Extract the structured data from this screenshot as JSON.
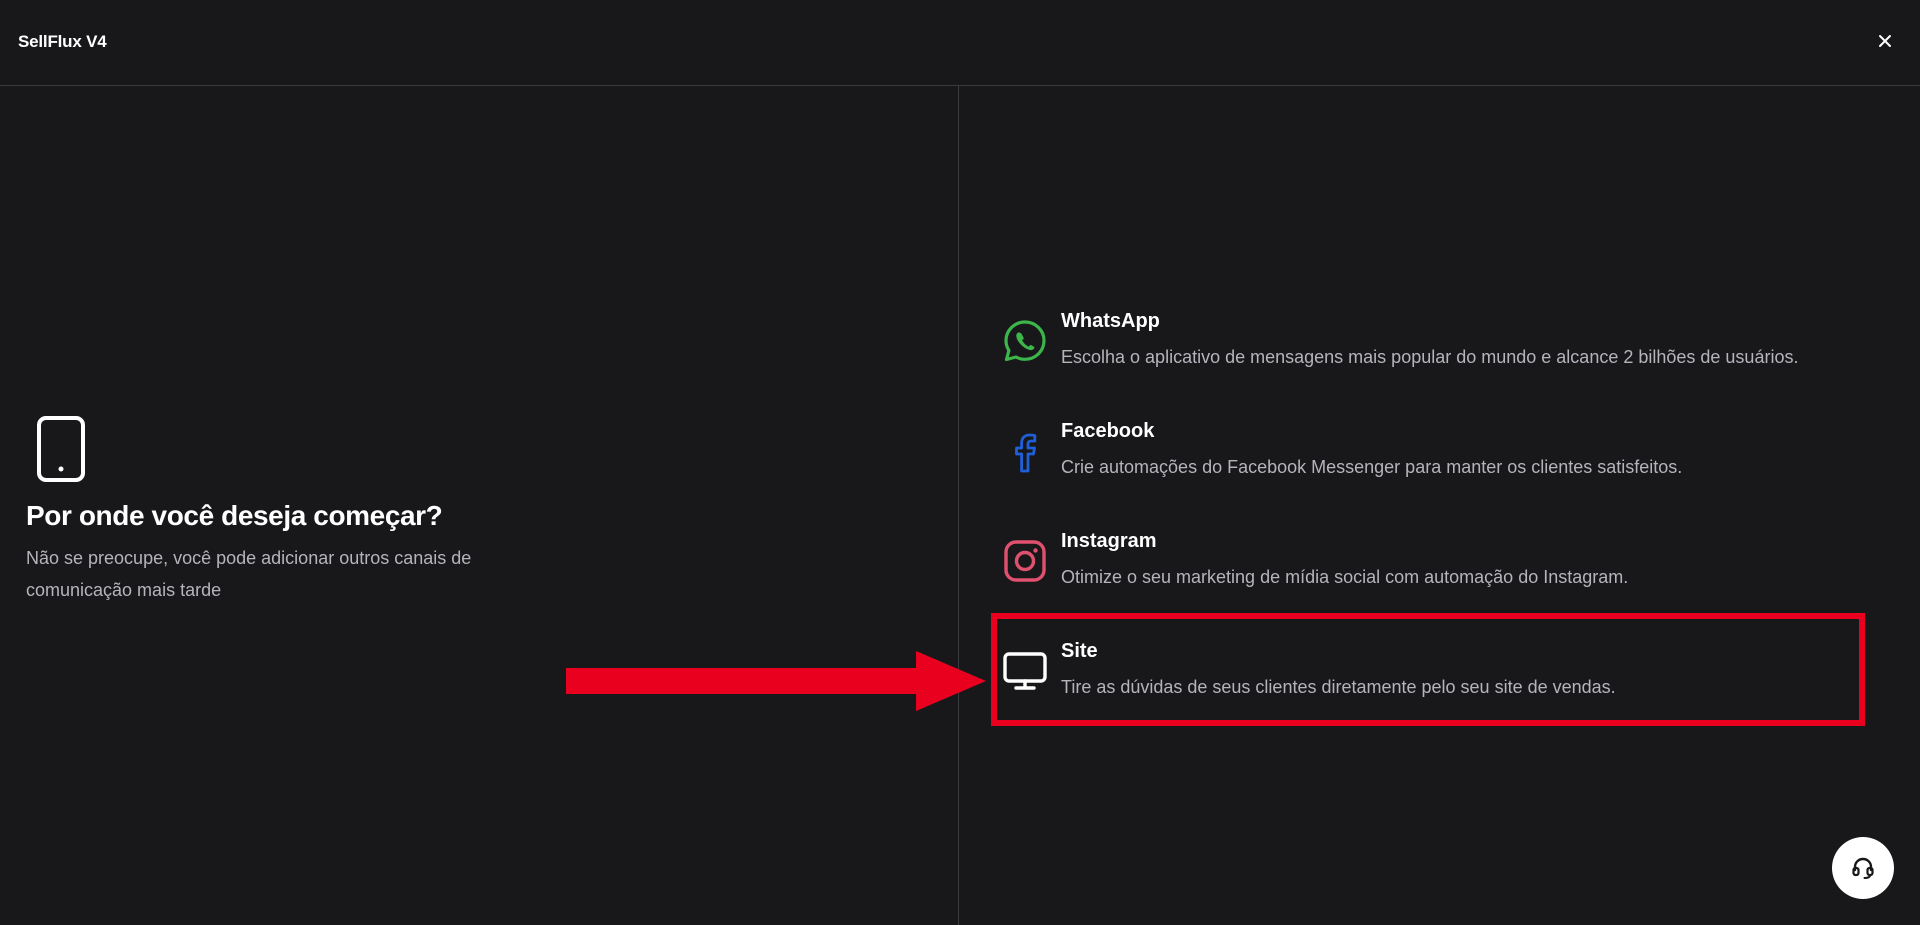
{
  "header": {
    "title": "SellFlux V4"
  },
  "left": {
    "title": "Por onde você deseja começar?",
    "subtitle_line1": "Não se preocupe, você pode adicionar outros canais de",
    "subtitle_line2": "comunicação mais tarde"
  },
  "channels": [
    {
      "name": "WhatsApp",
      "description": "Escolha o aplicativo de mensagens mais popular do mundo e alcance 2 bilhões de usuários.",
      "icon": "whatsapp-icon",
      "color": "#3cb54a"
    },
    {
      "name": "Facebook",
      "description": "Crie automações do Facebook Messenger para manter os clientes satisfeitos.",
      "icon": "facebook-icon",
      "color": "#1f5fd8"
    },
    {
      "name": "Instagram",
      "description": "Otimize o seu marketing de mídia social com automação do Instagram.",
      "icon": "instagram-icon",
      "color": "#e0506f"
    },
    {
      "name": "Site",
      "description": "Tire as dúvidas de seus clientes diretamente pelo seu site de vendas.",
      "icon": "monitor-icon",
      "color": "#ffffff"
    }
  ],
  "colors": {
    "background": "#18181b",
    "divider": "#3a3a3f",
    "highlight": "#e8001e",
    "muted_text": "#b4b4bb"
  }
}
